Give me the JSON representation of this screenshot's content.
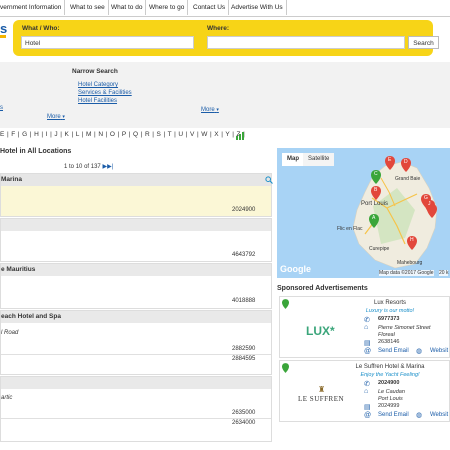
{
  "nav": {
    "tabs": [
      "vernment Information",
      "What to see",
      "What to do",
      "Where to go",
      "Contact Us",
      "Advertise With Us"
    ]
  },
  "logo": {
    "text": "s"
  },
  "search": {
    "what_label": "What / Who:",
    "what_value": "Hotel",
    "where_label": "Where:",
    "where_value": "",
    "button_label": "Search"
  },
  "narrow": {
    "title": "Narrow Search",
    "links": [
      "Hotel Category",
      "Services & Facilities",
      "Hotel Facilities"
    ],
    "left_link": "s",
    "more_left": "More",
    "more_right": "More"
  },
  "alphabet": "E | F | G | H | I | J | K | L | M | N | O | P | Q | R | S | T | U | V | W | X | Y | Z |",
  "results": {
    "heading_pre": "Hotel in ",
    "heading_loc": "All Locations",
    "pager": {
      "from": "1",
      "to": "10",
      "total": "137",
      "to_word": "to",
      "of_word": "of"
    }
  },
  "listings": [
    {
      "title": "Marina",
      "phones": [
        "2024900"
      ],
      "address": ""
    },
    {
      "title": "",
      "phones": [
        "4643792"
      ],
      "address": ""
    },
    {
      "title": "e Mauritius",
      "phones": [
        "4018888"
      ],
      "address": ""
    },
    {
      "title": "each Hotel and Spa",
      "phones": [
        "2882590",
        "2884595"
      ],
      "address": "l Road"
    },
    {
      "title": "",
      "phones": [
        "2635000",
        "2634000"
      ],
      "address": "artic"
    }
  ],
  "map": {
    "tab_map": "Map",
    "tab_satellite": "Satellite",
    "places": [
      "Grand Baie",
      "Port Louis",
      "Flic en Flac",
      "Curepipe",
      "Mahebourg"
    ],
    "markers": [
      "E",
      "D",
      "B",
      "C",
      "A",
      "H",
      "G",
      "I",
      "J"
    ],
    "google": "Google",
    "attribution": "Map data ©2017 Google",
    "scale": "20 k"
  },
  "sponsored": {
    "title": "Sponsored Advertisements",
    "ads": [
      {
        "name": "Lux Resorts",
        "slogan": "Luxury is our motto!",
        "phone": "6977373",
        "address_1": "Pierre Simonet Street",
        "address_2": "Floreal",
        "fax": "2638146",
        "logo_text": "LUX*",
        "send_email": "Send Email",
        "website": "Websit"
      },
      {
        "name": "Le Suffren Hotel & Marina",
        "slogan": "Enjoy the Yacht Feeling!",
        "phone": "2024900",
        "address_1": "Le Caudan",
        "address_2": "Port Louis",
        "fax": "2024999",
        "logo_text": "LE SUFFREN",
        "send_email": "Send Email",
        "website": "Websit"
      }
    ]
  },
  "colors": {
    "accent_yellow": "#f7d417",
    "link_blue": "#1a5ca8",
    "highlight": "#fbf7d6"
  }
}
